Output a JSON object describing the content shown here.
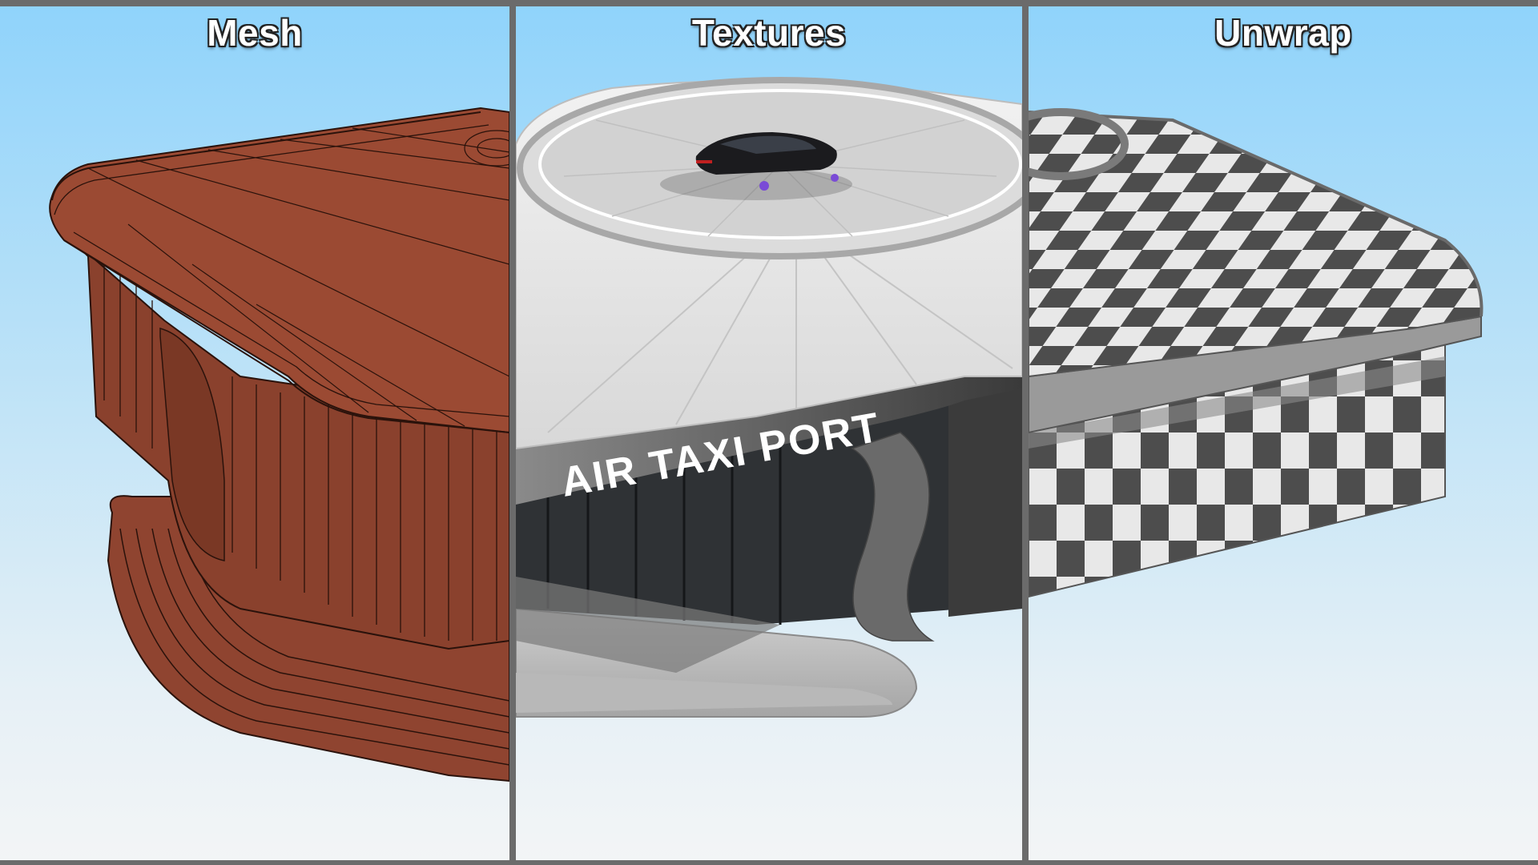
{
  "panels": {
    "mesh": {
      "title": "Mesh"
    },
    "textures": {
      "title": "Textures",
      "sign": "AIR TAXI PORT"
    },
    "unwrap": {
      "title": "Unwrap"
    }
  },
  "colors": {
    "sky_top": "#8fd3fb",
    "sky_bottom": "#f3f5f6",
    "divider": "#6b6b6b",
    "mesh_clay": "#9b4a33",
    "mesh_clay_dark": "#7d3a27",
    "texture_white": "#e6e6e6",
    "texture_dark": "#4a4a4a",
    "checker_light": "#e8e8e8",
    "checker_dark": "#4d4d4d"
  }
}
